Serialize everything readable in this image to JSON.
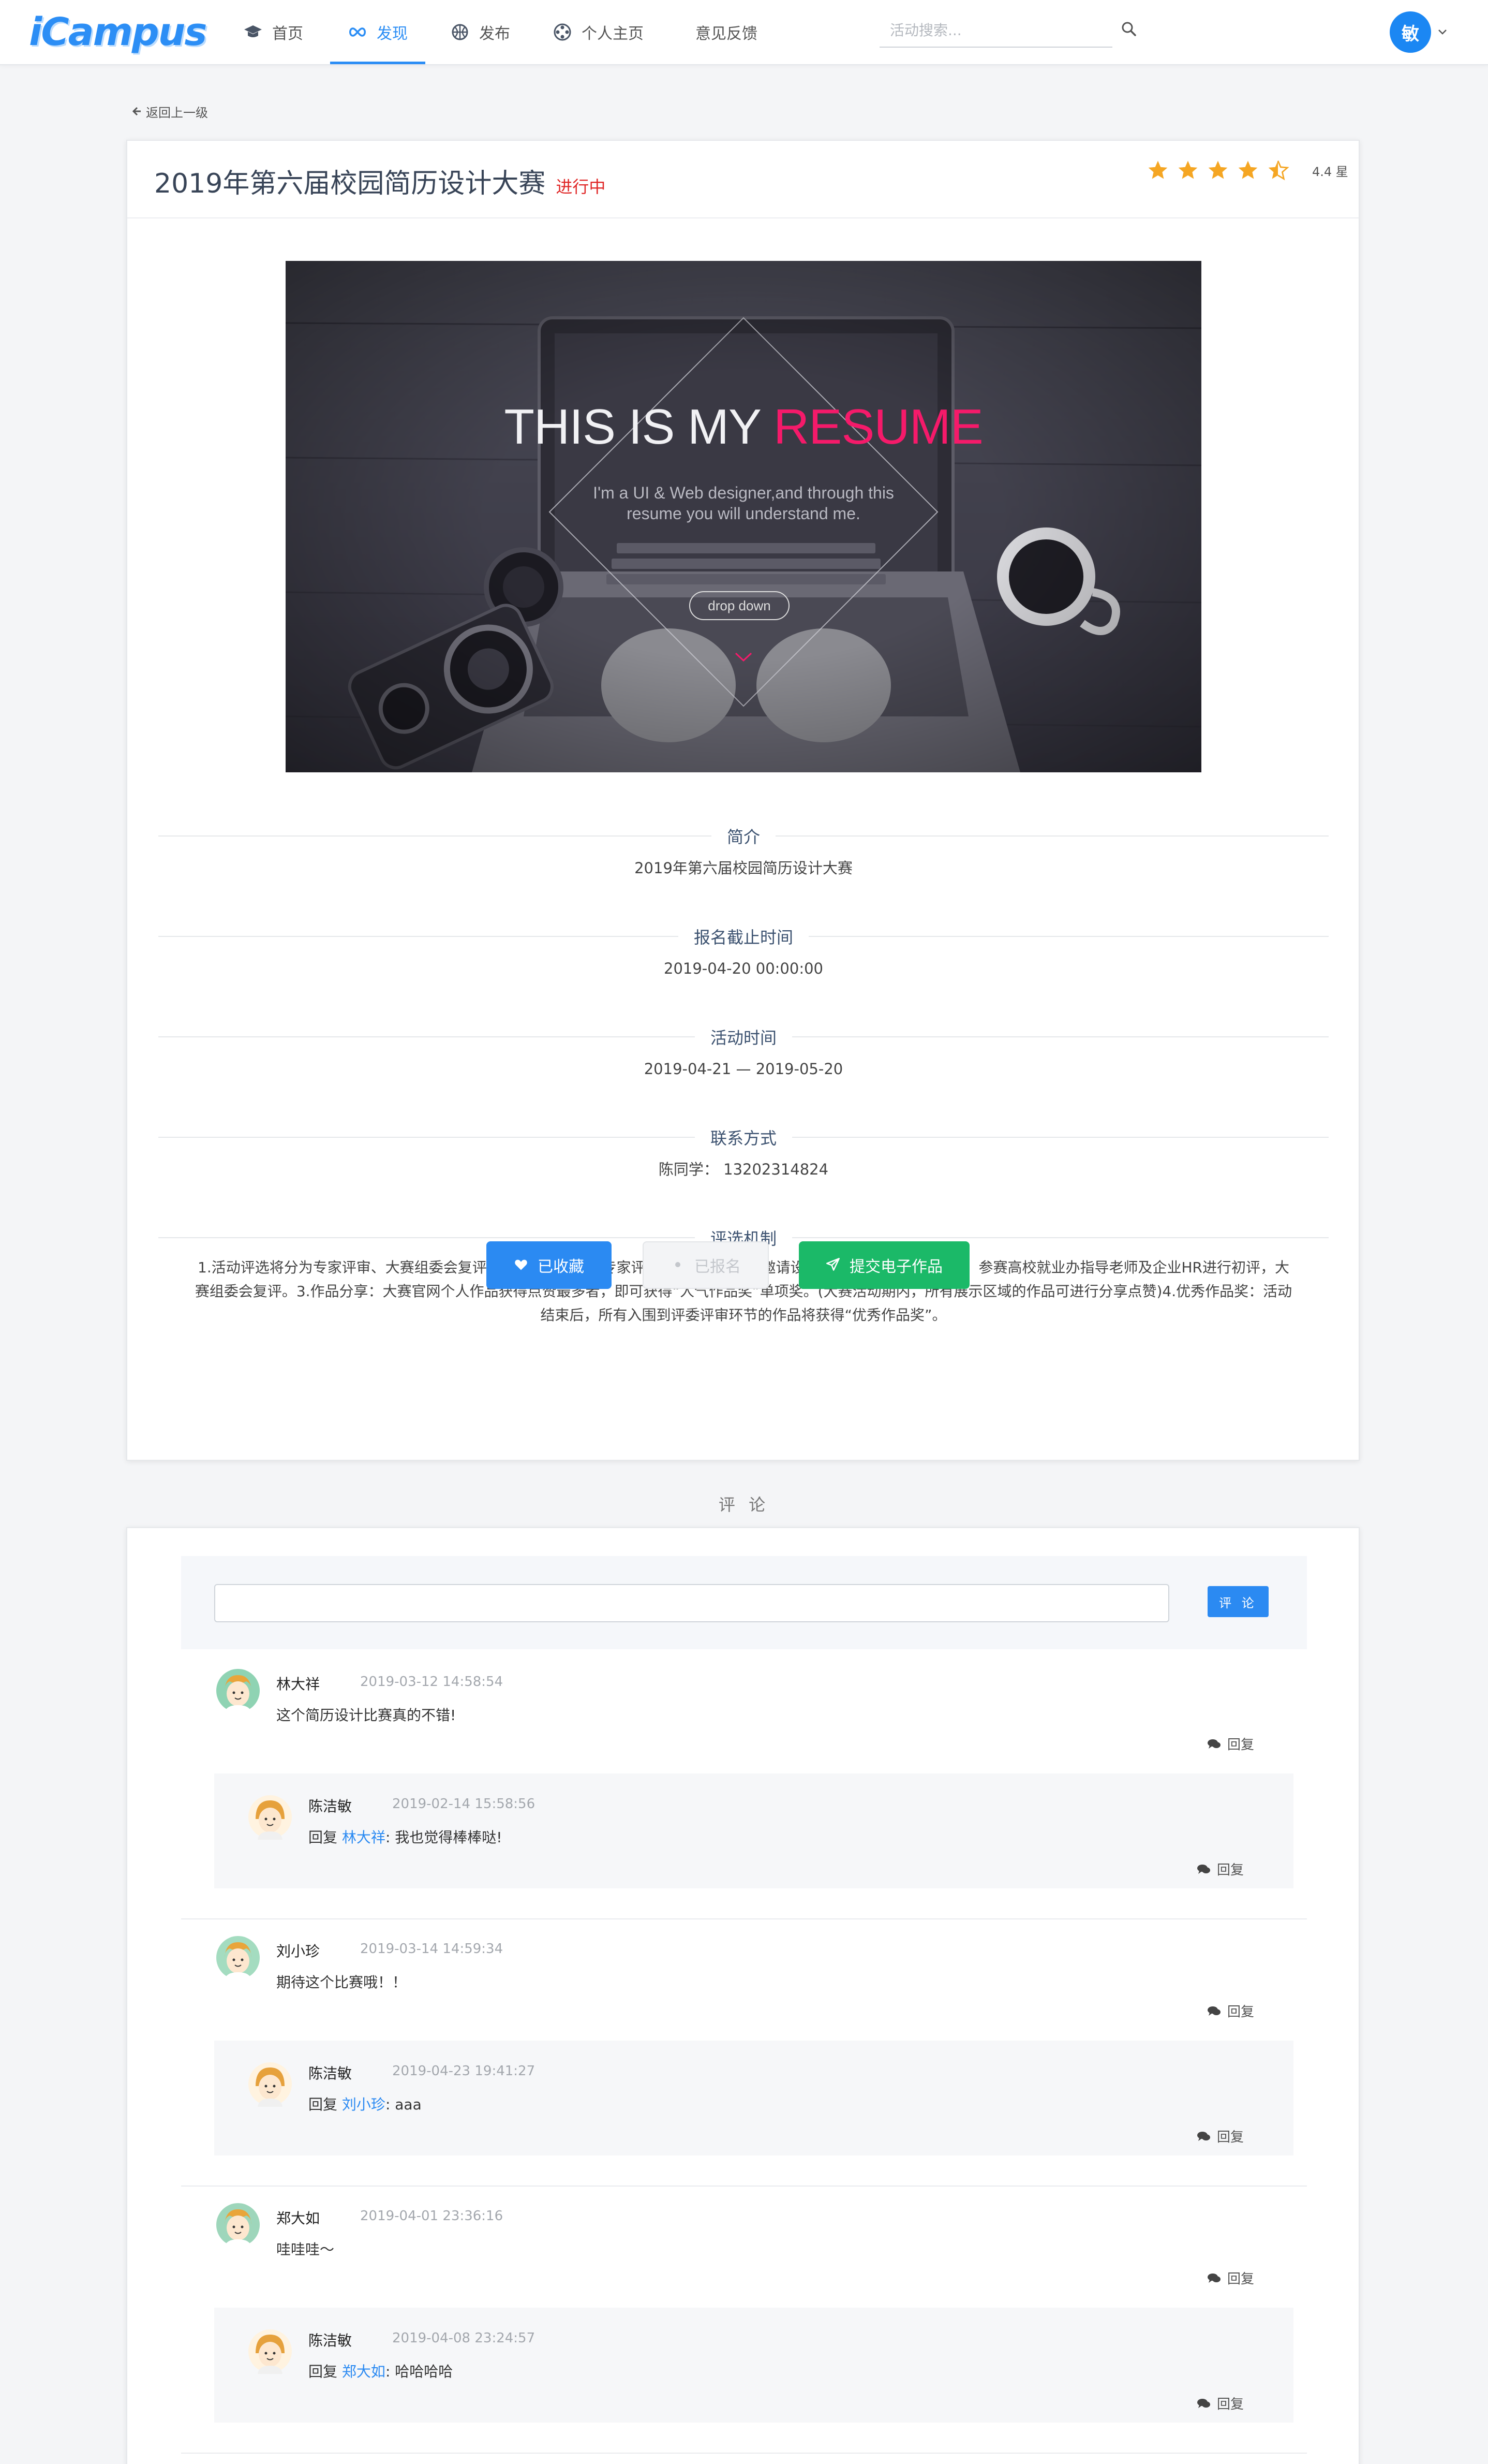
{
  "nav": {
    "logo": "iCampus",
    "items": [
      {
        "label": "首页",
        "icon": "graduation-cap-icon"
      },
      {
        "label": "发现",
        "icon": "infinity-icon",
        "active": true
      },
      {
        "label": "发布",
        "icon": "basketball-icon"
      },
      {
        "label": "个人主页",
        "icon": "film-reel-icon"
      },
      {
        "label": "意见反馈"
      }
    ],
    "search_placeholder": "活动搜索...",
    "user_initial": "敏"
  },
  "back_link": "返回上一级",
  "event": {
    "title": "2019年第六届校园简历设计大赛",
    "status": "进行中",
    "rating_value": 4.4,
    "rating_text": "4.4 星",
    "hero": {
      "headline_a": "THIS IS MY ",
      "headline_b": "RESUME",
      "sub_line1": "I'm a UI & Web designer,and through this",
      "sub_line2": "resume you will understand me.",
      "button": "drop down"
    },
    "sections": [
      {
        "label": "简介",
        "value": "2019年第六届校园简历设计大赛"
      },
      {
        "label": "报名截止时间",
        "value": "2019-04-20 00:00:00"
      },
      {
        "label": "活动时间",
        "value": "2019-04-21 — 2019-05-20"
      },
      {
        "label": "联系方式",
        "value": "陈同学： 13202314824"
      },
      {
        "label": "评选机制",
        "value_lines": [
          "1.活动评选将分为专家评审、大赛组委会复评二种评选方式。2.专家评审：大赛组委会将邀请设计学院院长、图书馆馆长、参赛高校就业办指导老师及企业HR进行初评，大",
          "赛组委会复评。3.作品分享：大赛官网个人作品获得点赞最多者，即可获得“人气作品奖”单项奖。(大赛活动期内，所有展示区域的作品可进行分享点赞)4.优秀作品奖：活动",
          "结束后，所有入围到评委评审环节的作品将获得“优秀作品奖”。"
        ]
      }
    ],
    "buttons": {
      "favorite": "已收藏",
      "enrolled": "已报名",
      "submit": "提交电子作品"
    }
  },
  "comments": {
    "title": "评 论",
    "input_placeholder": "",
    "submit_label": "评 论",
    "reply_label": "回复",
    "reply_prefix": "回复",
    "threads": [
      {
        "name": "林大祥",
        "time": "2019-03-12 14:58:54",
        "text": "这个简历设计比赛真的不错!",
        "reply": {
          "name": "陈洁敏",
          "time": "2019-02-14 15:58:56",
          "to": "林大祥",
          "text": ": 我也觉得棒棒哒!"
        }
      },
      {
        "name": "刘小珍",
        "time": "2019-03-14 14:59:34",
        "text": "期待这个比赛哦！！",
        "reply": {
          "name": "陈洁敏",
          "time": "2019-04-23 19:41:27",
          "to": "刘小珍",
          "text": ": aaa"
        }
      },
      {
        "name": "郑大如",
        "time": "2019-04-01 23:36:16",
        "text": "哇哇哇～",
        "reply": {
          "name": "陈洁敏",
          "time": "2019-04-08 23:24:57",
          "to": "郑大如",
          "text": ": 哈哈哈哈"
        }
      }
    ]
  },
  "colors": {
    "accent": "#2b8af2",
    "status_red": "#e02828",
    "success": "#1bb968",
    "star": "#f5a623"
  }
}
